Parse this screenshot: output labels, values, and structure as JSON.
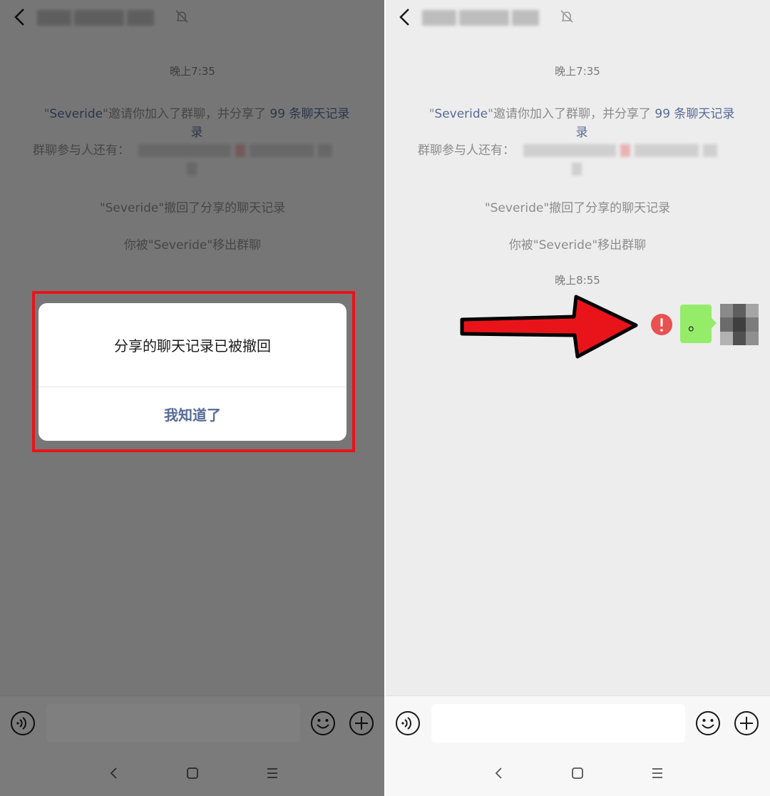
{
  "chat": {
    "time_1": "晚上7:35",
    "time_2": "晚上8:55",
    "invite_quote_open": "\"",
    "invite_name": "Severide",
    "invite_mid": "\"邀请你加入了群聊，并分享了",
    "invite_count": "99 条聊天记录",
    "participants_label": "群聊参与人还有：",
    "revoke_notice": "\"Severide\"撤回了分享的聊天记录",
    "removed_notice": "你被\"Severide\"移出群聊",
    "sent_message": "。"
  },
  "dialog": {
    "message": "分享的聊天记录已被撤回",
    "button": "我知道了"
  },
  "icons": {
    "back": "back-chevron-icon",
    "mute": "bell-off-icon",
    "voice": "voice-icon",
    "emoji": "emoji-icon",
    "plus": "plus-icon",
    "error": "error-exclamation-icon",
    "annotation_arrow": "red-arrow"
  },
  "colors": {
    "link": "#576b95",
    "highlight": "#e8141a",
    "bubble": "#95ec69",
    "error": "#e95050"
  }
}
